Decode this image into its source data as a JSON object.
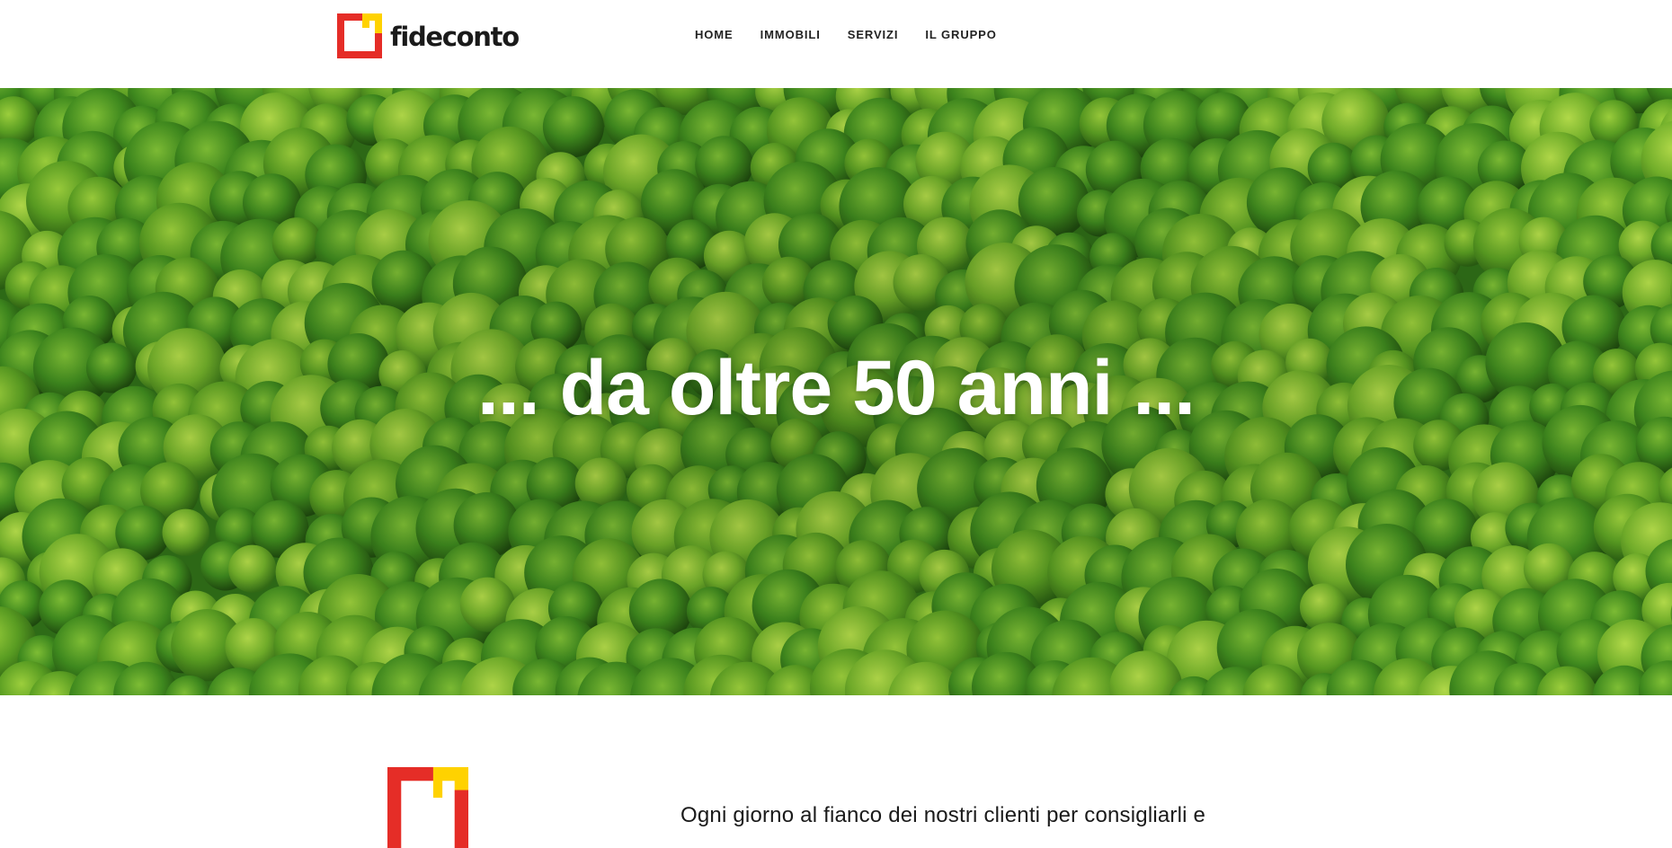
{
  "header": {
    "logo_text": "fideconto",
    "nav": [
      {
        "label": "HOME"
      },
      {
        "label": "IMMOBILI"
      },
      {
        "label": "SERVIZI"
      },
      {
        "label": "IL GRUPPO"
      }
    ]
  },
  "hero": {
    "title": "... da oltre 50 anni ..."
  },
  "intro": {
    "text": "Ogni giorno al fianco dei nostri clienti per consigliarli e"
  },
  "colors": {
    "brand_red": "#e52d27",
    "brand_yellow": "#ffd200",
    "forest_green": "#3f8a1e"
  }
}
